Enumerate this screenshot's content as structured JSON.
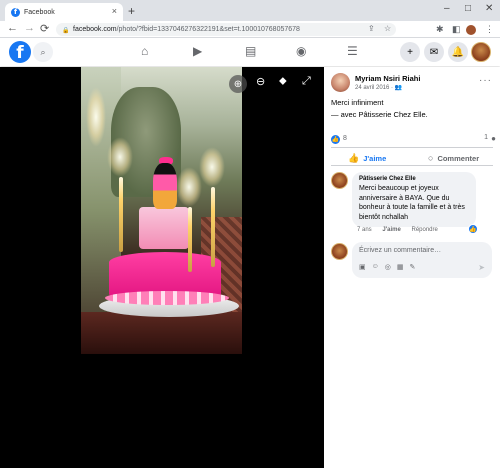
{
  "browser": {
    "tab_title": "Facebook",
    "tab_close": "×",
    "new_tab": "+",
    "window_controls": {
      "minimize": "–",
      "maximize": "□",
      "close": "✕"
    },
    "nav": {
      "back": "←",
      "forward": "→",
      "reload": "⟳"
    },
    "url_host": "facebook.com",
    "url_path": "/photo/?fbid=1337046276322191&set=t.100010768057678",
    "address_icons": [
      "share-icon",
      "star-icon"
    ],
    "extension_icons": [
      "puzzle-icon",
      "sidebar-icon"
    ]
  },
  "fb_header": {
    "logo": "f",
    "search_icon": "⌕",
    "nav_icons": [
      "home-icon",
      "video-icon",
      "marketplace-icon",
      "groups-icon",
      "menu-icon"
    ],
    "actions": [
      "create-icon",
      "messenger-icon",
      "notifications-icon"
    ]
  },
  "viewer": {
    "tools": [
      "zoom-in-icon",
      "zoom-out-icon",
      "tag-icon",
      "fullscreen-icon"
    ]
  },
  "post": {
    "author": "Myriam Nsiri Riahi",
    "date": "24 avril 2016 · 👥",
    "text": "Merci infiniment",
    "with_text": "— avec Pâtisserie Chez Elle.",
    "like_count": "8",
    "comment_count": "1",
    "like_action": "J'aime",
    "comment_action": "Commenter",
    "more": "···"
  },
  "comments": [
    {
      "author": "Pâtisserie Chez Elle",
      "text": "Merci beaucoup et joyeux anniversaire à BAYA. Que du bonheur à toute la famille et à très bientôt nchallah",
      "age": "7 ans",
      "like": "J'aime",
      "reply": "Répondre"
    }
  ],
  "composer": {
    "placeholder": "Écrivez un commentaire…"
  },
  "colors": {
    "facebook_blue": "#1877f2",
    "viewer_bg": "#000000",
    "bubble_bg": "#f0f2f5"
  }
}
